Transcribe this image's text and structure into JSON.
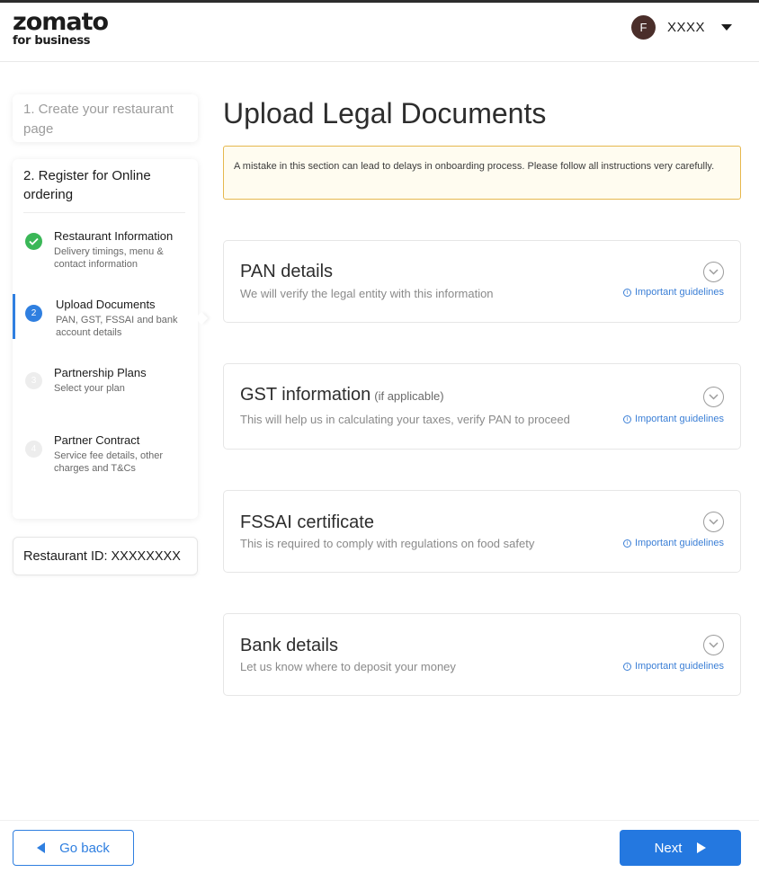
{
  "header": {
    "logo_main": "zomato",
    "logo_sub": "for business",
    "user_initial": "F",
    "user_name": "XXXX"
  },
  "sidebar": {
    "step1_label": "1. Create your restaurant page",
    "step2_label": "2. Register for Online ordering",
    "substeps": [
      {
        "number": "✓",
        "title": "Restaurant Information",
        "desc": "Delivery timings, menu & contact information",
        "status": "done"
      },
      {
        "number": "2",
        "title": "Upload Documents",
        "desc": "PAN, GST, FSSAI and bank account details",
        "status": "active"
      },
      {
        "number": "3",
        "title": "Partnership Plans",
        "desc": "Select your plan",
        "status": "pending"
      },
      {
        "number": "4",
        "title": "Partner Contract",
        "desc": "Service fee details, other charges and T&Cs",
        "status": "pending"
      }
    ],
    "restaurant_id": "Restaurant ID: XXXXXXXX"
  },
  "main": {
    "title": "Upload Legal Documents",
    "warning": "A mistake in this section can lead to delays in onboarding process. Please follow all instructions very carefully.",
    "guidelines_label": "Important guidelines",
    "sections": [
      {
        "title": "PAN details",
        "optional": "",
        "desc": "We will verify the legal entity with this information"
      },
      {
        "title": "GST information",
        "optional": "(if applicable)",
        "desc": "This will help us in calculating your taxes, verify PAN to proceed"
      },
      {
        "title": "FSSAI certificate",
        "optional": "",
        "desc": "This is required to comply with regulations on food safety"
      },
      {
        "title": "Bank details",
        "optional": "",
        "desc": "Let us know where to deposit your money"
      }
    ]
  },
  "footer": {
    "back_label": "Go back",
    "next_label": "Next"
  },
  "colors": {
    "accent": "#2f7fe0",
    "success": "#3ab757",
    "warning_border": "#e6b84e",
    "warning_bg": "#fffcf0"
  }
}
